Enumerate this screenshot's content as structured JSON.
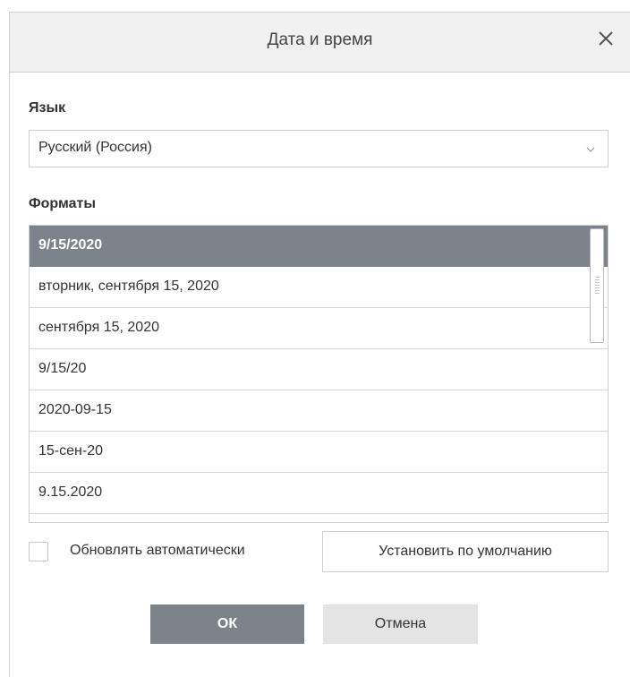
{
  "dialog": {
    "title": "Дата и время",
    "close_icon": "close-icon"
  },
  "language": {
    "label": "Язык",
    "selected": "Русский (Россия)",
    "caret_icon": "chevron-down-icon"
  },
  "formats": {
    "label": "Форматы",
    "selected_index": 0,
    "items": [
      "9/15/2020",
      "вторник, сентября 15, 2020",
      "сентября 15, 2020",
      "9/15/20",
      "2020-09-15",
      "15-сен-20",
      "9.15.2020"
    ]
  },
  "auto_update": {
    "label": "Обновлять автоматически",
    "checked": false
  },
  "buttons": {
    "set_default": "Установить по умолчанию",
    "ok": "ОК",
    "cancel": "Отмена"
  },
  "colors": {
    "selected_row": "#7c838a",
    "primary_button": "#7c838a",
    "secondary_button": "#e4e4e4",
    "titlebar": "#f1f1f1"
  }
}
